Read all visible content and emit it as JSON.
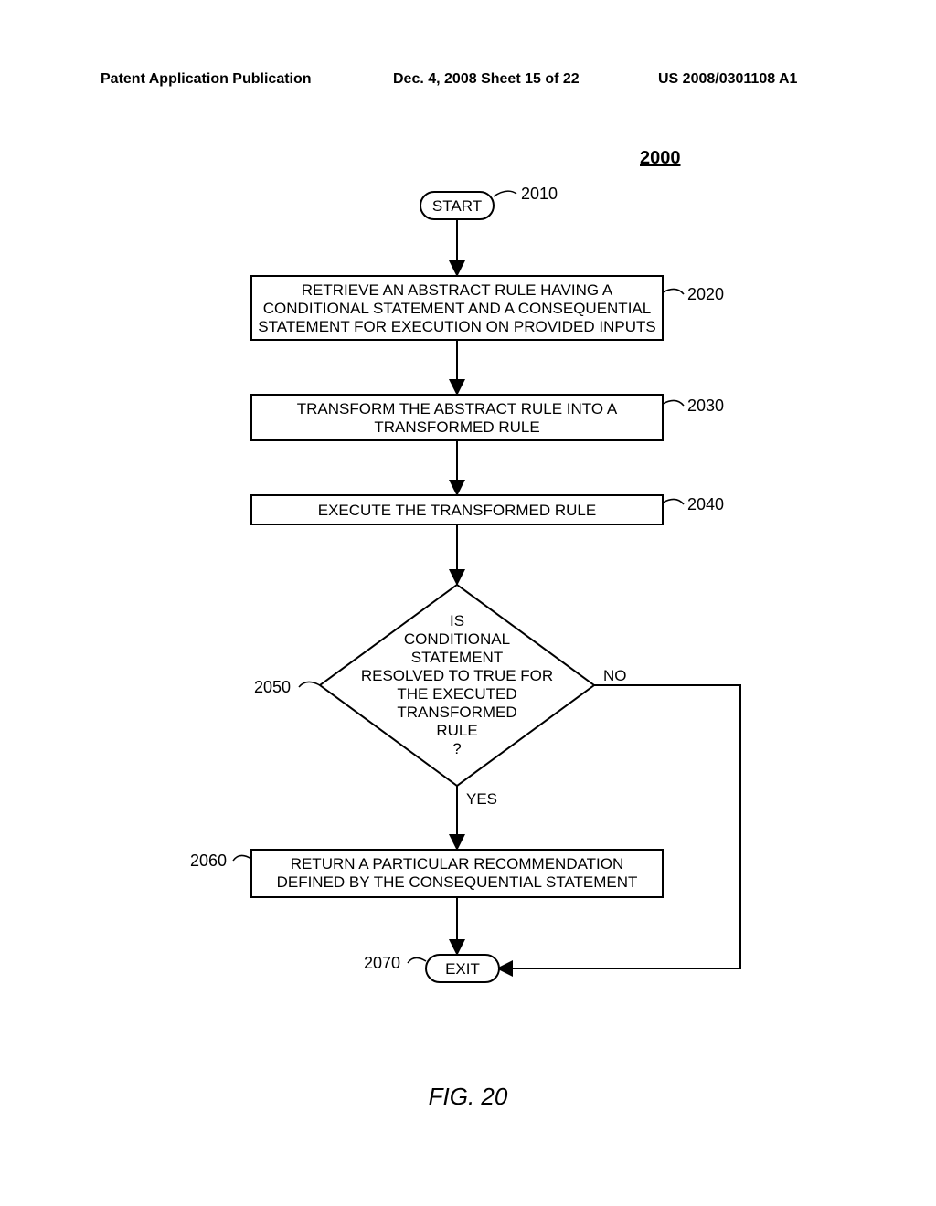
{
  "header": {
    "left": "Patent Application Publication",
    "middle": "Dec. 4, 2008  Sheet 15 of 22",
    "right": "US 2008/0301108 A1"
  },
  "figure": {
    "ref": "2000",
    "caption": "FIG. 20"
  },
  "nodes": {
    "start": {
      "label": "START",
      "ref": "2010"
    },
    "step1": {
      "l1": "RETRIEVE AN ABSTRACT RULE HAVING A",
      "l2": "CONDITIONAL STATEMENT AND A CONSEQUENTIAL",
      "l3": "STATEMENT FOR EXECUTION ON PROVIDED INPUTS",
      "ref": "2020"
    },
    "step2": {
      "l1": "TRANSFORM THE ABSTRACT RULE INTO A",
      "l2": "TRANSFORMED RULE",
      "ref": "2030"
    },
    "step3": {
      "l1": "EXECUTE THE TRANSFORMED RULE",
      "ref": "2040"
    },
    "decision": {
      "l1": "IS",
      "l2": "CONDITIONAL",
      "l3": "STATEMENT",
      "l4": "RESOLVED TO TRUE FOR",
      "l5": "THE EXECUTED",
      "l6": "TRANSFORMED",
      "l7": "RULE",
      "l8": "?",
      "ref": "2050",
      "yes": "YES",
      "no": "NO"
    },
    "step4": {
      "l1": "RETURN A PARTICULAR RECOMMENDATION",
      "l2": "DEFINED BY THE CONSEQUENTIAL STATEMENT",
      "ref": "2060"
    },
    "exit": {
      "label": "EXIT",
      "ref": "2070"
    }
  }
}
